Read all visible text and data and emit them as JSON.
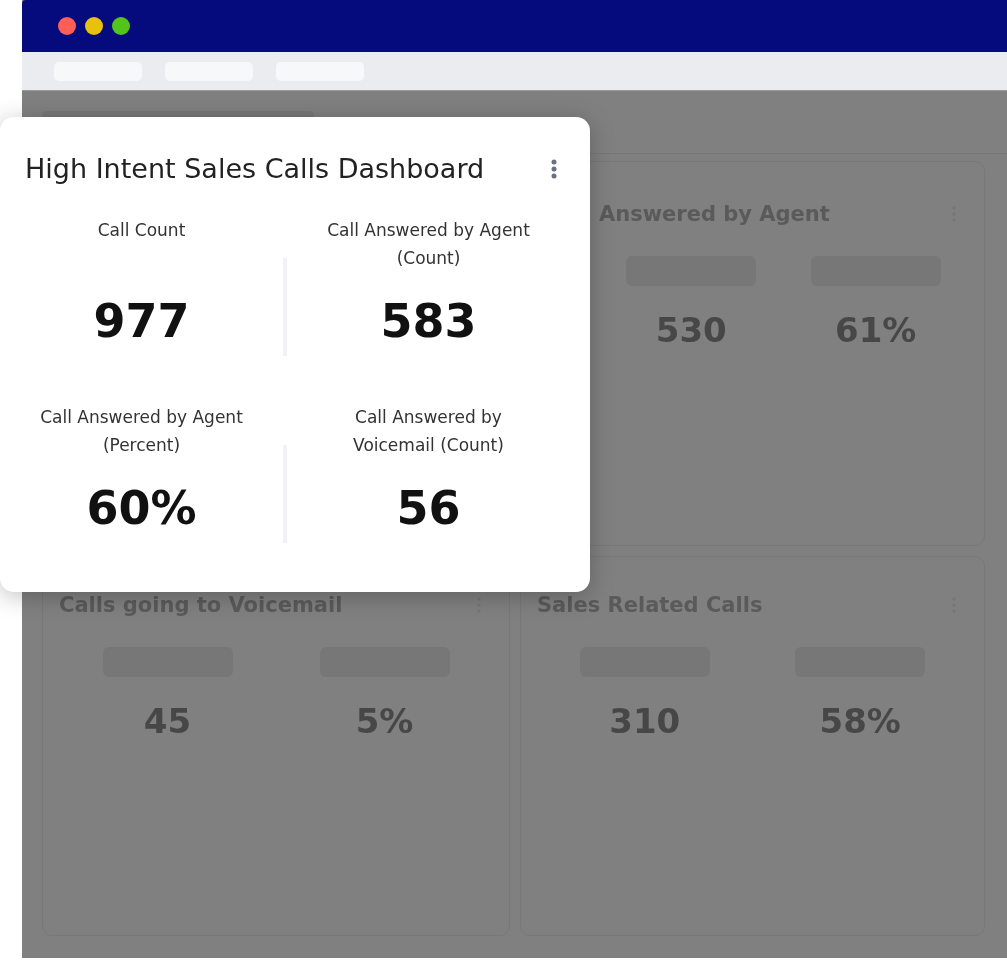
{
  "window_controls": [
    {
      "color": "#ff5f57"
    },
    {
      "color": "#e8c00e"
    },
    {
      "color": "#52c41a"
    }
  ],
  "background_panels": [
    {
      "title": "Answered by Agent",
      "values": [
        "530",
        "61%"
      ]
    },
    {
      "title": "Calls going to Voicemail",
      "values": [
        "45",
        "5%"
      ]
    },
    {
      "title": "Sales Related Calls",
      "values": [
        "310",
        "58%"
      ]
    }
  ],
  "card": {
    "title": "High Intent Sales Calls Dashboard",
    "metrics": [
      {
        "label": "Call Count",
        "value": "977"
      },
      {
        "label": "Call Answered by Agent (Count)",
        "value": "583"
      },
      {
        "label": "Call Answered by Agent (Percent)",
        "value": "60%"
      },
      {
        "label": "Call Answered by Voicemail (Count)",
        "value": "56"
      }
    ]
  }
}
